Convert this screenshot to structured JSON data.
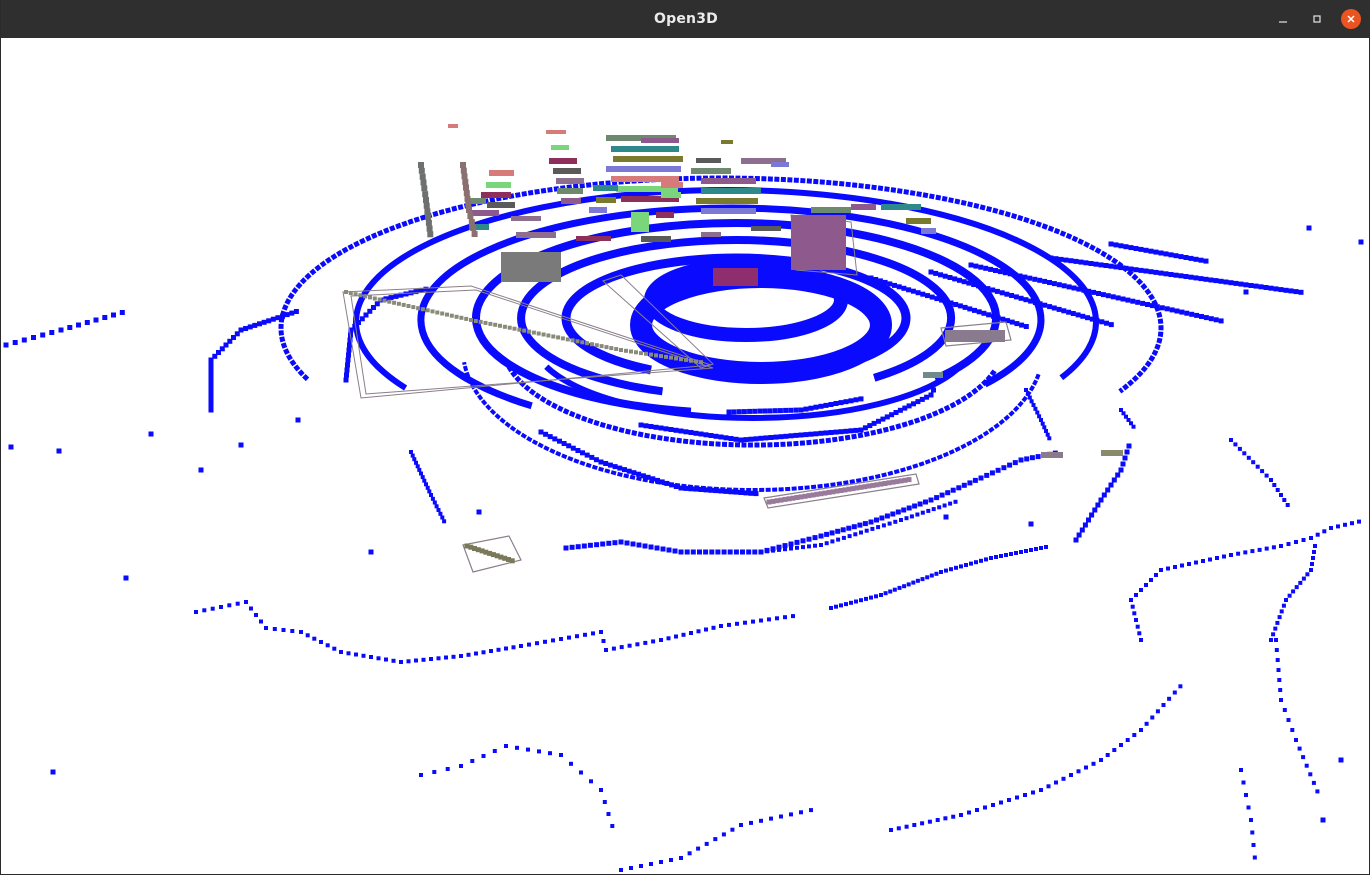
{
  "window": {
    "title": "Open3D",
    "controls": [
      "minimize",
      "maximize",
      "close"
    ]
  },
  "scene": {
    "background": "#ffffff",
    "ground_point_color": "#0a0aff",
    "box_outline_color": "#8a7f8a",
    "object_point_colors": [
      "#6e8a6e",
      "#8e5a8e",
      "#2e8a8a",
      "#7a7a2e",
      "#7a7ad6",
      "#d67a7a",
      "#7ad67a",
      "#8e2e5a",
      "#5a5a5a",
      "#8e6e8e"
    ]
  }
}
